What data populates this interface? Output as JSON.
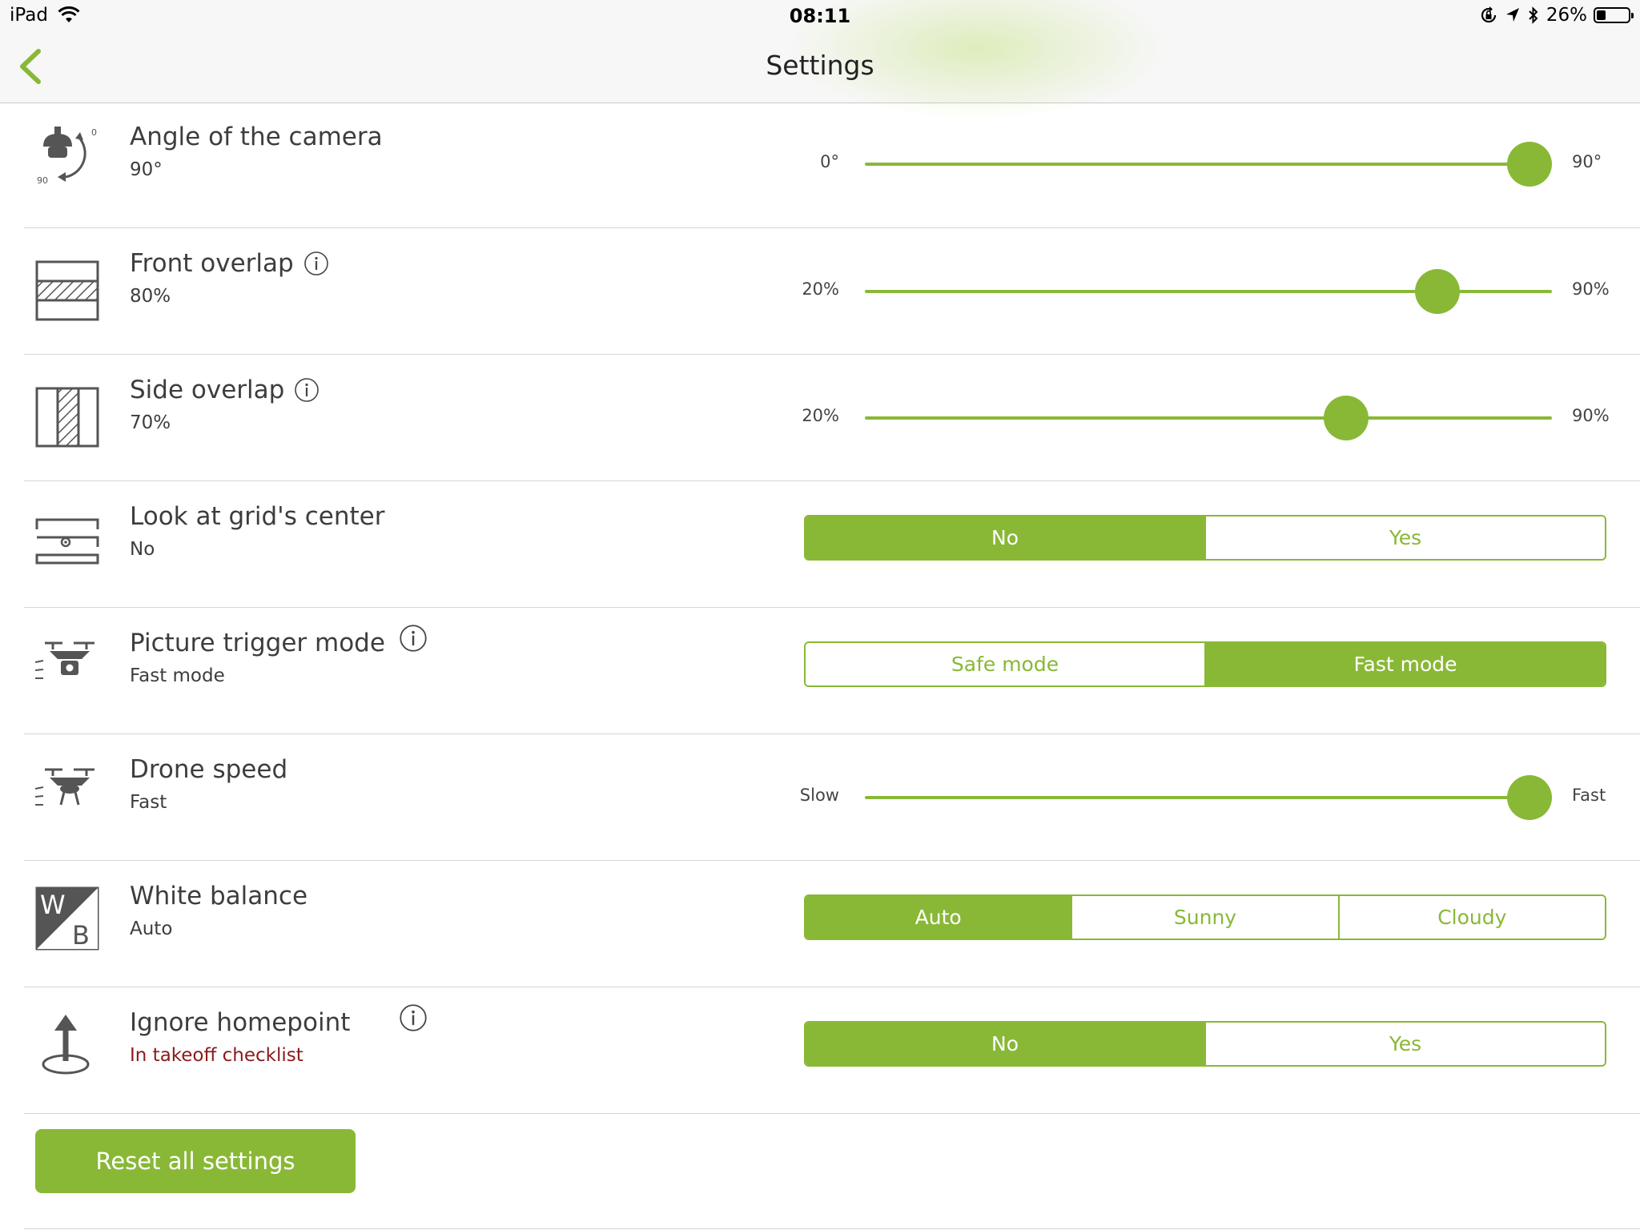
{
  "status_bar": {
    "device": "iPad",
    "time": "08:11",
    "battery_text": "26%",
    "battery_level": 0.26
  },
  "nav": {
    "title": "Settings"
  },
  "rows": [
    {
      "title": "Angle of the camera",
      "value": "90°",
      "control": {
        "type": "slider",
        "min_label": "0°",
        "max_label": "90°",
        "level": 1.0
      }
    },
    {
      "title": "Front overlap",
      "value": "80%",
      "control": {
        "type": "slider",
        "min_label": "20%",
        "max_label": "90%",
        "level": 0.857
      }
    },
    {
      "title": "Side overlap",
      "value": "70%",
      "control": {
        "type": "slider",
        "min_label": "20%",
        "max_label": "90%",
        "level": 0.714
      }
    },
    {
      "title": "Look at grid's center",
      "value": "No",
      "control": {
        "type": "segmented",
        "options": [
          "No",
          "Yes"
        ],
        "selected": 0
      }
    },
    {
      "title": "Picture trigger mode",
      "value": "Fast mode",
      "control": {
        "type": "segmented",
        "options": [
          "Safe mode",
          "Fast mode"
        ],
        "selected": 1
      }
    },
    {
      "title": "Drone speed",
      "value": "Fast",
      "control": {
        "type": "slider",
        "min_label": "Slow",
        "max_label": "Fast",
        "level": 1.0
      }
    },
    {
      "title": "White balance",
      "value": "Auto",
      "control": {
        "type": "segmented",
        "options": [
          "Auto",
          "Sunny",
          "Cloudy"
        ],
        "selected": 0
      }
    },
    {
      "title": "Ignore homepoint",
      "value": "In takeoff checklist",
      "control": {
        "type": "segmented",
        "options": [
          "No",
          "Yes"
        ],
        "selected": 0
      }
    }
  ],
  "reset_label": "Reset all settings",
  "colors": {
    "accent": "#89b836",
    "warning_text": "#8b1a1a"
  }
}
